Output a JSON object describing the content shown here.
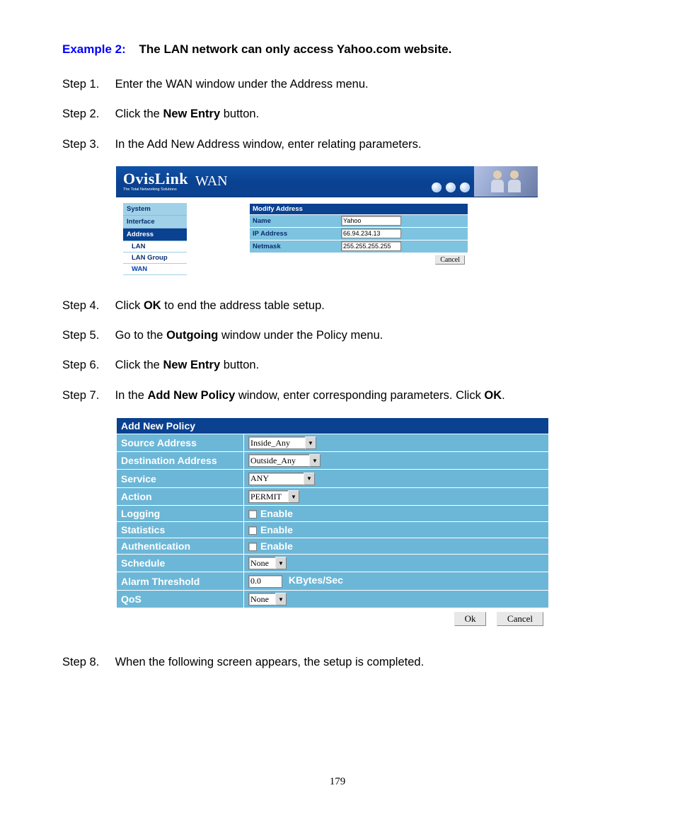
{
  "example": {
    "label": "Example 2:",
    "title": "The LAN network can only access Yahoo.com website."
  },
  "steps": {
    "s1_label": "Step 1.",
    "s1_text": "Enter the WAN window under the Address menu.",
    "s2_label": "Step 2.",
    "s2_pre": "Click the ",
    "s2_bold": "New Entry",
    "s2_post": " button.",
    "s3_label": "Step 3.",
    "s3_text": "In the Add New Address window, enter relating parameters.",
    "s4_label": "Step 4.",
    "s4_pre": "Click ",
    "s4_bold": "OK",
    "s4_post": " to end the address table setup.",
    "s5_label": "Step 5.",
    "s5_pre": "Go to the ",
    "s5_bold": "Outgoing",
    "s5_post": " window under the Policy menu.",
    "s6_label": "Step 6.",
    "s6_pre": "Click the ",
    "s6_bold": "New Entry",
    "s6_post": " button.",
    "s7_label": "Step 7.",
    "s7_pre": "In the ",
    "s7_bold1": "Add New Policy",
    "s7_mid": " window, enter corresponding parameters. Click ",
    "s7_bold2": "OK",
    "s7_post": ".",
    "s8_label": "Step 8.",
    "s8_text": "When the following screen appears, the setup is completed."
  },
  "shot1": {
    "brand": "OvisLink",
    "tagline": "The Total Networking Solutions",
    "page_title": "WAN",
    "nav": {
      "item0": "System",
      "item1": "Interface",
      "item2": "Address",
      "sub0": "LAN",
      "sub1": "LAN Group",
      "sub2": "WAN"
    },
    "form": {
      "header": "Modify Address",
      "name_lbl": "Name",
      "name_val": "Yahoo",
      "ip_lbl": "IP Address",
      "ip_val": "66.94.234.13",
      "mask_lbl": "Netmask",
      "mask_val": "255.255.255.255",
      "cancel": "Cancel"
    }
  },
  "shot2": {
    "header": "Add New Policy",
    "rows": {
      "src_lbl": "Source Address",
      "src_val": "Inside_Any",
      "dst_lbl": "Destination Address",
      "dst_val": "Outside_Any",
      "svc_lbl": "Service",
      "svc_val": "ANY",
      "act_lbl": "Action",
      "act_val": "PERMIT",
      "log_lbl": "Logging",
      "log_val": "Enable",
      "stat_lbl": "Statistics",
      "stat_val": "Enable",
      "auth_lbl": "Authentication",
      "auth_val": "Enable",
      "sched_lbl": "Schedule",
      "sched_val": "None",
      "alarm_lbl": "Alarm Threshold",
      "alarm_val": "0.0",
      "alarm_unit": "KBytes/Sec",
      "qos_lbl": "QoS",
      "qos_val": "None"
    },
    "ok": "Ok",
    "cancel": "Cancel"
  },
  "page_number": "179"
}
